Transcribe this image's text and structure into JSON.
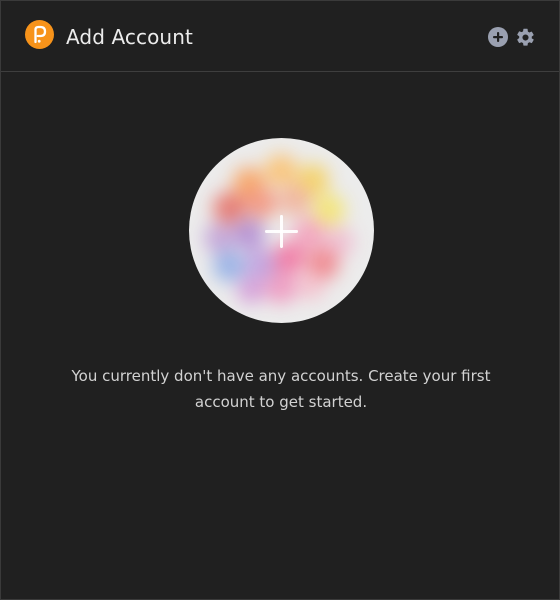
{
  "header": {
    "title": "Add Account",
    "logo_icon": "polkadot-p-logo",
    "add_icon": "plus-circle-icon",
    "settings_icon": "gear-icon"
  },
  "main": {
    "avatar_icon": "plus-icon",
    "message": "You currently don't have any accounts. Create your first account to get started."
  },
  "colors": {
    "background": "#202020",
    "accent": "#f7931a",
    "icon": "#9aa0b0",
    "text": "#d2d2d2"
  }
}
